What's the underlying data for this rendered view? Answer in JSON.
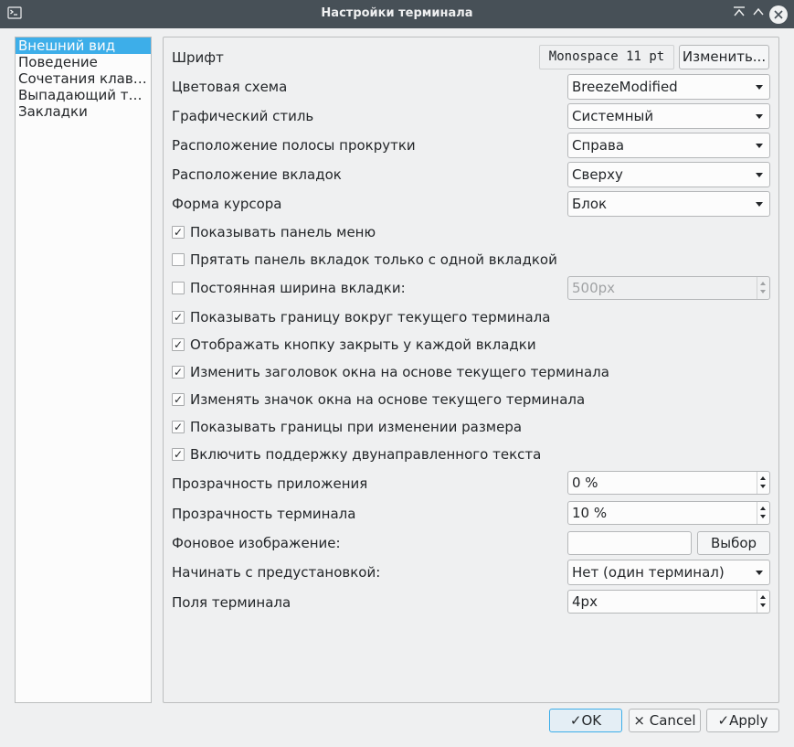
{
  "window": {
    "title": "Настройки терминала"
  },
  "sidebar": {
    "items": [
      {
        "label": "Внешний вид"
      },
      {
        "label": "Поведение"
      },
      {
        "label": "Сочетания клав…"
      },
      {
        "label": "Выпадающий т…"
      },
      {
        "label": "Закладки"
      }
    ]
  },
  "appearance": {
    "font": {
      "label": "Шрифт",
      "value": "Monospace 11 pt",
      "change_button": "Изменить..."
    },
    "color_scheme": {
      "label": "Цветовая схема",
      "value": "BreezeModified"
    },
    "widget_style": {
      "label": "Графический стиль",
      "value": "Системный"
    },
    "scrollbar_position": {
      "label": "Расположение полосы прокрутки",
      "value": "Справа"
    },
    "tabs_position": {
      "label": "Расположение вкладок",
      "value": "Сверху"
    },
    "cursor_shape": {
      "label": "Форма курсора",
      "value": "Блок"
    },
    "checkboxes": [
      {
        "label": "Показывать панель меню",
        "checked": true
      },
      {
        "label": "Прятать панель вкладок только с одной вкладкой",
        "checked": false
      },
      {
        "label": "Постоянная ширина вкладки:",
        "checked": false
      },
      {
        "label": "Показывать границу вокруг текущего терминала",
        "checked": true
      },
      {
        "label": "Отображать кнопку закрыть у каждой вкладки",
        "checked": true
      },
      {
        "label": "Изменить заголовок окна на основе текущего терминала",
        "checked": true
      },
      {
        "label": "Изменять значок окна на основе текущего терминала",
        "checked": true
      },
      {
        "label": "Показывать границы при изменении размера",
        "checked": true
      },
      {
        "label": "Включить поддержку двунаправленного текста",
        "checked": true
      }
    ],
    "fixed_tab_width": {
      "value": "500px"
    },
    "app_opacity": {
      "label": "Прозрачность приложения",
      "value": "0 %"
    },
    "term_opacity": {
      "label": "Прозрачность терминала",
      "value": "10 %"
    },
    "background_image": {
      "label": "Фоновое изображение:",
      "value": "",
      "choose_button": "Выбор"
    },
    "start_preset": {
      "label": "Начинать с предустановкой:",
      "value": "Нет (один терминал)"
    },
    "terminal_margin": {
      "label": "Поля терминала",
      "value": "4px"
    }
  },
  "buttons": {
    "ok": "OK",
    "cancel": "Cancel",
    "apply": "Apply"
  },
  "icons": {
    "check": "✓",
    "close": "×"
  },
  "colors": {
    "titlebar": "#475057",
    "selection": "#3daee9",
    "window_bg": "#eff0f1"
  }
}
